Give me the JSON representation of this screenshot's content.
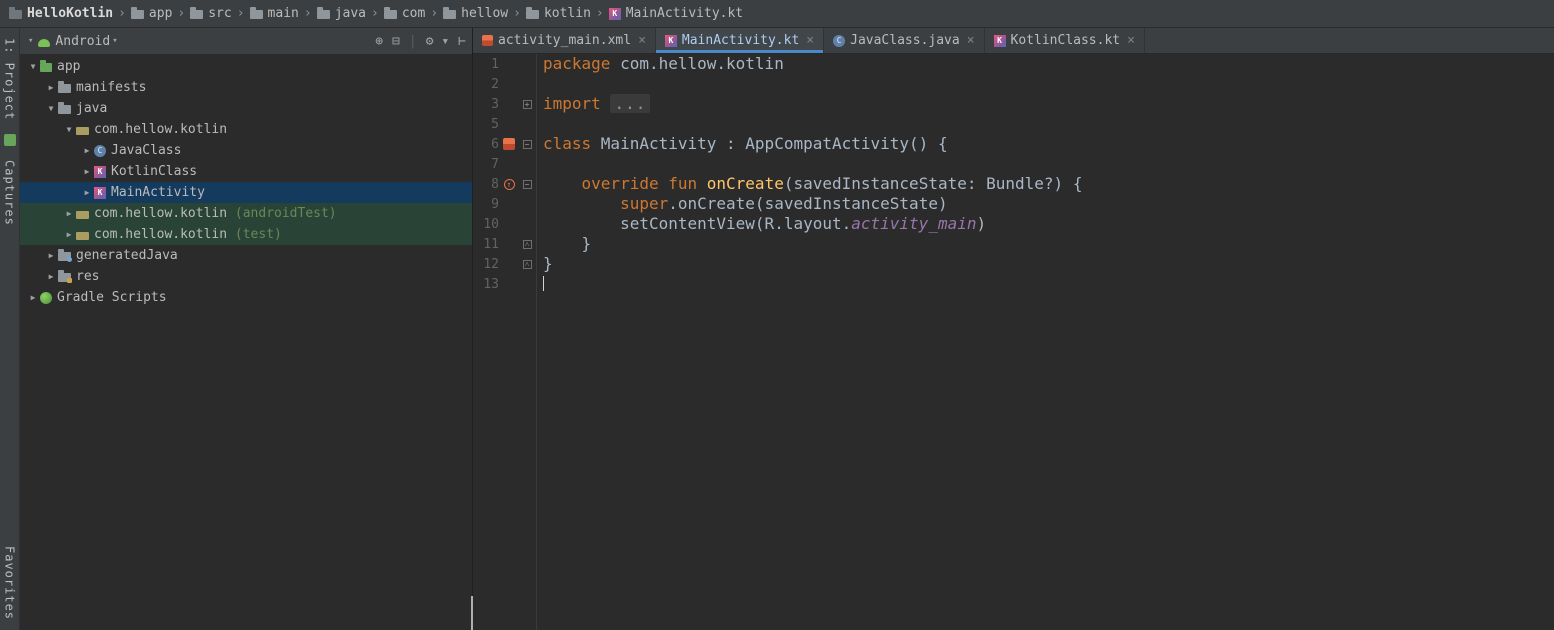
{
  "colors": {
    "accent_blue": "#4a88c7",
    "selection_row": "#143a5e",
    "test_row_green": "#294436",
    "keyword_orange": "#cc7832",
    "function_yellow": "#ffc66b",
    "reference_purple": "#9876aa",
    "editor_bg": "#2b2b2b",
    "panel_bg": "#3c3f41"
  },
  "breadcrumb": {
    "separator": "›",
    "items": [
      {
        "label": "HelloKotlin",
        "icon": "project",
        "bold": true
      },
      {
        "label": "app",
        "icon": "folder"
      },
      {
        "label": "src",
        "icon": "folder"
      },
      {
        "label": "main",
        "icon": "folder"
      },
      {
        "label": "java",
        "icon": "folder"
      },
      {
        "label": "com",
        "icon": "folder"
      },
      {
        "label": "hellow",
        "icon": "folder"
      },
      {
        "label": "kotlin",
        "icon": "folder"
      },
      {
        "label": "MainActivity.kt",
        "icon": "kotlin-file"
      }
    ]
  },
  "tool_stripe": {
    "top": [
      {
        "label": "1: Project",
        "icon": "project"
      },
      {
        "label": "Captures",
        "icon": "captures"
      }
    ],
    "bottom": [
      {
        "label": "Favorites"
      }
    ]
  },
  "project_panel": {
    "selector_label": "Android",
    "selector_chevron": "▾",
    "toolbar_icons": [
      {
        "name": "locate",
        "glyph": "⊕"
      },
      {
        "name": "collapse-all",
        "glyph": "⊟"
      },
      {
        "name": "separator",
        "glyph": "|"
      },
      {
        "name": "settings",
        "glyph": "⚙ ▾"
      },
      {
        "name": "hide",
        "glyph": "⊢"
      }
    ],
    "tree": [
      {
        "label": "app",
        "icon": "app-module",
        "level": 0,
        "chevron": "expanded"
      },
      {
        "label": "manifests",
        "icon": "folder",
        "level": 1,
        "chevron": "collapsed"
      },
      {
        "label": "java",
        "icon": "folder",
        "level": 1,
        "chevron": "expanded"
      },
      {
        "label": "com.hellow.kotlin",
        "icon": "package",
        "level": 2,
        "chevron": "expanded"
      },
      {
        "label": "JavaClass",
        "icon": "java-class",
        "level": 3,
        "chevron": "collapsed"
      },
      {
        "label": "KotlinClass",
        "icon": "kotlin-class",
        "level": 3,
        "chevron": "collapsed"
      },
      {
        "label": "MainActivity",
        "icon": "kotlin-class",
        "level": 3,
        "chevron": "collapsed",
        "selected": true
      },
      {
        "label": "com.hellow.kotlin",
        "suffix": " (androidTest)",
        "icon": "package",
        "level": 2,
        "chevron": "collapsed",
        "highlight": "green"
      },
      {
        "label": "com.hellow.kotlin",
        "suffix": " (test)",
        "icon": "package",
        "level": 2,
        "chevron": "collapsed",
        "highlight": "green"
      },
      {
        "label": "generatedJava",
        "icon": "folder-gen",
        "level": 1,
        "chevron": "collapsed"
      },
      {
        "label": "res",
        "icon": "folder-res",
        "level": 1,
        "chevron": "collapsed"
      },
      {
        "label": "Gradle Scripts",
        "icon": "gradle",
        "level": 0,
        "chevron": "collapsed"
      }
    ]
  },
  "editor": {
    "close_glyph": "×",
    "tabs": [
      {
        "label": "activity_main.xml",
        "icon": "layout-file",
        "active": false
      },
      {
        "label": "MainActivity.kt",
        "icon": "kotlin-file",
        "active": true
      },
      {
        "label": "JavaClass.java",
        "icon": "java-file",
        "active": false
      },
      {
        "label": "KotlinClass.kt",
        "icon": "kotlin-file",
        "active": false
      }
    ],
    "lines": [
      {
        "num": "1",
        "tokens": [
          {
            "t": "package ",
            "s": "kw"
          },
          {
            "t": "com.hellow.kotlin",
            "s": "p"
          }
        ]
      },
      {
        "num": "2",
        "tokens": []
      },
      {
        "num": "3",
        "fold": "plus",
        "tokens": [
          {
            "t": "import ",
            "s": "kw"
          },
          {
            "t": "...",
            "s": "fold"
          }
        ]
      },
      {
        "num": "5",
        "tokens": []
      },
      {
        "num": "6",
        "gutter_icon": "android",
        "fold": "minus",
        "tokens": [
          {
            "t": "class ",
            "s": "kw"
          },
          {
            "t": "MainActivity : AppCompatActivity() {",
            "s": "p"
          }
        ]
      },
      {
        "num": "7",
        "tokens": []
      },
      {
        "num": "8",
        "gutter_icon": "override",
        "fold": "minus",
        "tokens": [
          {
            "t": "    ",
            "s": "p"
          },
          {
            "t": "override fun ",
            "s": "kw"
          },
          {
            "t": "onCreate",
            "s": "fn"
          },
          {
            "t": "(savedInstanceState: Bundle?) {",
            "s": "p"
          }
        ]
      },
      {
        "num": "9",
        "tokens": [
          {
            "t": "        ",
            "s": "p"
          },
          {
            "t": "super",
            "s": "kw"
          },
          {
            "t": ".onCreate(savedInstanceState)",
            "s": "p"
          }
        ]
      },
      {
        "num": "10",
        "tokens": [
          {
            "t": "        setContentView(R.layout.",
            "s": "p"
          },
          {
            "t": "activity_main",
            "s": "it"
          },
          {
            "t": ")",
            "s": "p"
          }
        ]
      },
      {
        "num": "11",
        "fold": "end",
        "tokens": [
          {
            "t": "    }",
            "s": "p"
          }
        ]
      },
      {
        "num": "12",
        "fold": "end",
        "tokens": [
          {
            "t": "}",
            "s": "p"
          }
        ]
      },
      {
        "num": "13",
        "caret": true,
        "tokens": []
      }
    ]
  }
}
